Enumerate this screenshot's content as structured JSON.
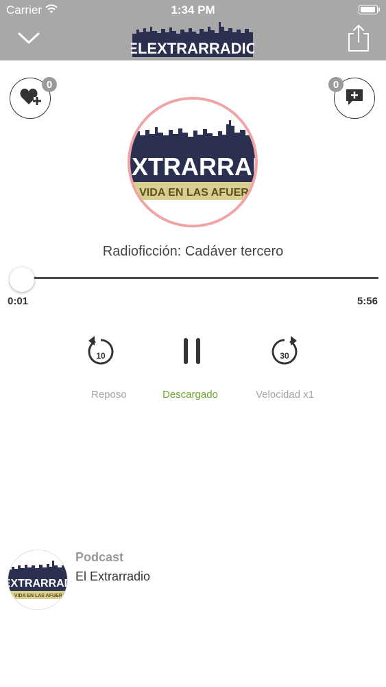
{
  "status_bar": {
    "carrier": "Carrier",
    "time": "1:34 PM"
  },
  "nav": {
    "logo_text": "ELEXTRARRADIO"
  },
  "badges": {
    "likes": "0",
    "comments": "0"
  },
  "artwork": {
    "line1": "EXTRARRAD",
    "line2": "A VIDA EN LAS AFUERA"
  },
  "episode": {
    "title": "Radioficción: Cadáver tercero"
  },
  "progress": {
    "elapsed": "0:01",
    "duration": "5:56",
    "fraction": 0.003
  },
  "controls": {
    "rewind_seconds": "10",
    "forward_seconds": "30"
  },
  "labels": {
    "reposo": "Reposo",
    "descargado": "Descargado",
    "velocidad": "Velocidad x1"
  },
  "podcast": {
    "heading": "Podcast",
    "name": "El Extrarradio",
    "thumb_line1": "EXTRARRAD",
    "thumb_line2": "A VIDA EN LAS AFUERA"
  },
  "colors": {
    "nav_bg": "#a8a8a8",
    "accent_green": "#6aa52a",
    "art_ring": "#f0a4a6",
    "badge": "#9b9b9b",
    "logo_navy": "#2b3050"
  }
}
